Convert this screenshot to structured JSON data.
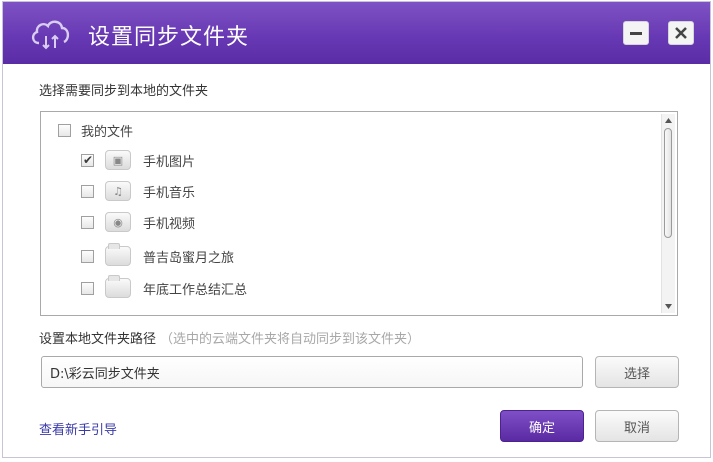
{
  "window": {
    "title": "设置同步文件夹",
    "icons": {
      "app": "cloud-sync-icon",
      "minimize": "minimize-icon",
      "close": "close-icon"
    },
    "colors": {
      "titlebar": "#6a3bb5",
      "accent": "#5a2aa2",
      "link": "#3a3aa8"
    }
  },
  "folder_select": {
    "label": "选择需要同步到本地的文件夹",
    "root": {
      "label": "我的文件",
      "checked": false
    },
    "items": [
      {
        "label": "手机图片",
        "checked": true,
        "icon": "image-icon",
        "glyph": "▣"
      },
      {
        "label": "手机音乐",
        "checked": false,
        "icon": "music-icon",
        "glyph": "♫"
      },
      {
        "label": "手机视频",
        "checked": false,
        "icon": "video-icon",
        "glyph": "◉"
      },
      {
        "label": "普吉岛蜜月之旅",
        "checked": false,
        "icon": "folder-icon",
        "glyph": ""
      },
      {
        "label": "年底工作总结汇总",
        "checked": false,
        "icon": "folder-icon",
        "glyph": ""
      }
    ]
  },
  "local_path": {
    "label": "设置本地文件夹路径",
    "hint": "（选中的云端文件夹将自动同步到该文件夹）",
    "value": "D:\\彩云同步文件夹",
    "select_button": "选择"
  },
  "footer": {
    "guide_link": "查看新手引导",
    "ok_button": "确定",
    "cancel_button": "取消"
  }
}
